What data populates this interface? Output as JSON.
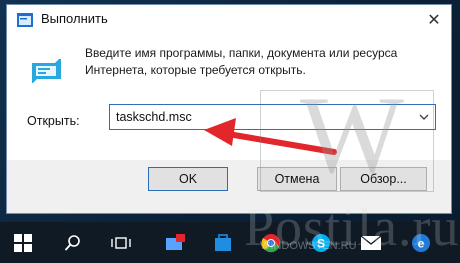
{
  "dialog": {
    "title": "Выполнить",
    "description": "Введите имя программы, папки, документа или ресурса Интернета, которые требуется открыть.",
    "open_label": "Открыть:",
    "input_value": "taskschd.msc",
    "buttons": {
      "ok": "OK",
      "cancel": "Отмена",
      "browse": "Обзор..."
    }
  },
  "watermark": {
    "letter": "W",
    "brand": "Postila.ru",
    "small": "WINDOWSTEN.RU"
  },
  "taskbar": {
    "items": [
      "start-icon",
      "search-icon",
      "task-view-icon",
      "app-red-badge-icon",
      "store-icon",
      "chrome-icon",
      "skype-icon",
      "mail-icon",
      "edge-icon"
    ]
  },
  "colors": {
    "accent": "#2a6fb8",
    "arrow": "#e3262b",
    "taskbar": "#0f1a24"
  }
}
